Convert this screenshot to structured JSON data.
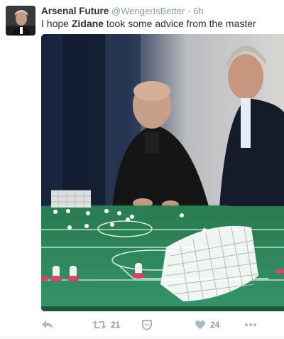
{
  "tweet": {
    "author_name": "Arsenal Future",
    "author_handle": "@WengerIsBetter",
    "separator": "·",
    "time": "6h",
    "text_before": "I hope ",
    "text_bold": "Zidane",
    "text_after": " took some advice from the master"
  },
  "actions": {
    "reply_icon": "reply-icon",
    "retweet_icon": "retweet-icon",
    "retweet_count": "21",
    "shield_icon": "shield-icon",
    "like_icon": "heart-icon",
    "like_count": "24",
    "more_icon": "more-dots-icon"
  },
  "colors": {
    "name": "#292f33",
    "meta": "#8899a6",
    "action_icon": "#aab8c2",
    "table_green": "#2f8a5a"
  }
}
